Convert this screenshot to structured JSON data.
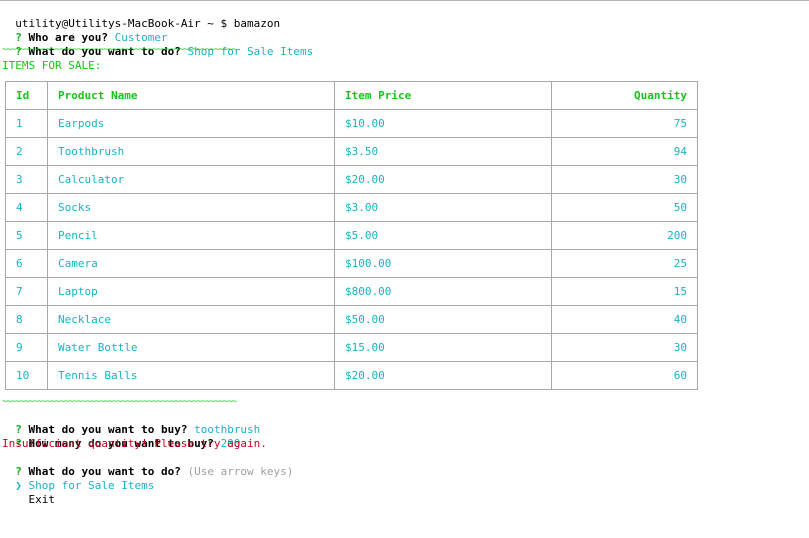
{
  "command_line": {
    "prompt": "utility@Utilitys-MacBook-Air ~ $ ",
    "command": "bamazon"
  },
  "prompts_top": [
    {
      "marker": "?",
      "question": "Who are you?",
      "answer": "Customer"
    },
    {
      "marker": "?",
      "question": "What do you want to do?",
      "answer": "Shop for Sale Items"
    }
  ],
  "separator": "~~~~~~~~~~~~~~~~~~~~~~~~~~~~~~~~~~~~~~~~~~~~~~~~~~~~~",
  "items_heading": "ITEMS FOR SALE:",
  "table": {
    "headers": [
      "Id",
      "Product Name",
      "Item Price",
      "Quantity"
    ],
    "rows": [
      {
        "id": "1",
        "name": "Earpods",
        "price": "$10.00",
        "qty": "75"
      },
      {
        "id": "2",
        "name": "Toothbrush",
        "price": "$3.50",
        "qty": "94"
      },
      {
        "id": "3",
        "name": "Calculator",
        "price": "$20.00",
        "qty": "30"
      },
      {
        "id": "4",
        "name": "Socks",
        "price": "$3.00",
        "qty": "50"
      },
      {
        "id": "5",
        "name": "Pencil",
        "price": "$5.00",
        "qty": "200"
      },
      {
        "id": "6",
        "name": "Camera",
        "price": "$100.00",
        "qty": "25"
      },
      {
        "id": "7",
        "name": "Laptop",
        "price": "$800.00",
        "qty": "15"
      },
      {
        "id": "8",
        "name": "Necklace",
        "price": "$50.00",
        "qty": "40"
      },
      {
        "id": "9",
        "name": "Water Bottle",
        "price": "$15.00",
        "qty": "30"
      },
      {
        "id": "10",
        "name": "Tennis Balls",
        "price": "$20.00",
        "qty": "60"
      }
    ]
  },
  "prompts_bottom": [
    {
      "marker": "?",
      "question": "What do you want to buy?",
      "answer": "toothbrush"
    },
    {
      "marker": "?",
      "question": "How many do you want to buy?",
      "answer": "200"
    }
  ],
  "error_message": "Insufficient quantity! Please try again.",
  "final_prompt": {
    "marker": "?",
    "question": "What do you want to do?",
    "hint": "(Use arrow keys)"
  },
  "menu": {
    "pointer": "❯",
    "options": [
      "Shop for Sale Items",
      "Exit"
    ],
    "selected_index": 0
  },
  "colors": {
    "answer": "#16b4c4",
    "heading": "#17c417",
    "error": "#c8001e",
    "hint": "#a0a0a0"
  }
}
